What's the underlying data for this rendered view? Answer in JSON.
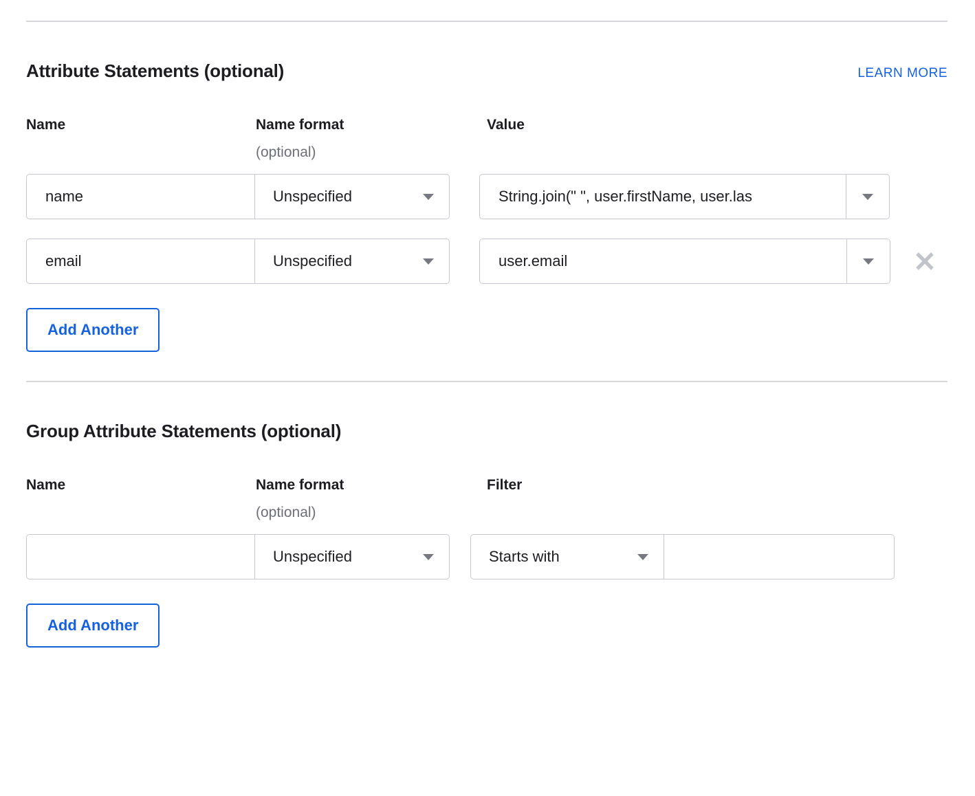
{
  "attribute_statements": {
    "title": "Attribute Statements (optional)",
    "learn_more_label": "LEARN MORE",
    "columns": {
      "name": "Name",
      "name_format": "Name format",
      "name_format_optional": "(optional)",
      "value": "Value"
    },
    "rows": [
      {
        "name_value": "name",
        "name_placeholder": "",
        "name_format_value": "Unspecified",
        "value_value": "String.join(\" \", user.firstName, user.las",
        "value_placeholder": "",
        "removable": false
      },
      {
        "name_value": "email",
        "name_placeholder": "",
        "name_format_value": "Unspecified",
        "value_value": "user.email",
        "value_placeholder": "",
        "removable": true,
        "remove_icon": "close-icon"
      }
    ],
    "add_another_label": "Add Another"
  },
  "group_attribute_statements": {
    "title": "Group Attribute Statements (optional)",
    "columns": {
      "name": "Name",
      "name_format": "Name format",
      "name_format_optional": "(optional)",
      "filter": "Filter"
    },
    "rows": [
      {
        "name_value": "",
        "name_placeholder": "",
        "name_format_value": "Unspecified",
        "filter_type_value": "Starts with",
        "filter_text_value": "",
        "filter_text_placeholder": ""
      }
    ],
    "add_another_label": "Add Another"
  },
  "icons": {
    "caret_down": "chevron-down-icon",
    "close": "close-icon"
  },
  "colors": {
    "link_blue": "#1662dd",
    "text_primary": "#1d1d21",
    "text_muted": "#6e6e78",
    "border": "#c8c8d0",
    "divider": "#d7d7dc",
    "icon_grey": "#c3c3cb"
  }
}
